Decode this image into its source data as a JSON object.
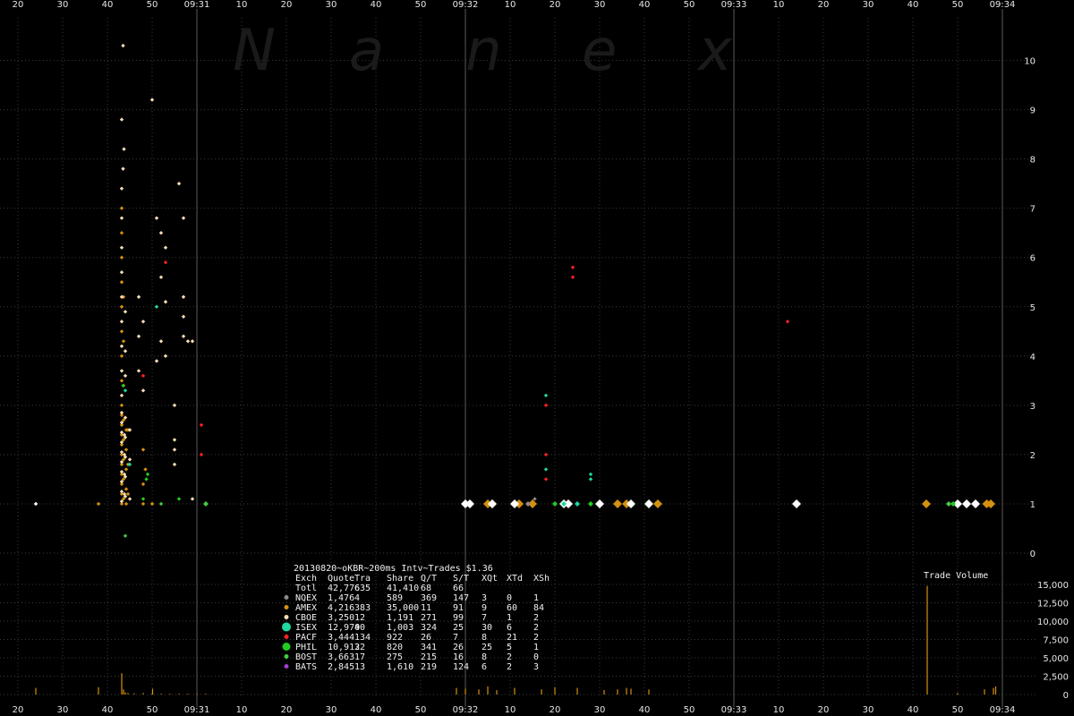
{
  "watermark": [
    "N",
    "a",
    "n",
    "e",
    "x"
  ],
  "colors": {
    "background": "#000000",
    "grid_dot": "#3a3a3a",
    "minute_line": "#5a5a5a",
    "NQEX": "#8c8c8c",
    "AMEX": "#d4900f",
    "CBOE": "#f5deb3",
    "ISEX": "#20d8a0",
    "PACF": "#ff2020",
    "PHIL": "#22cc22",
    "BOST": "#44cc44",
    "BATS": "#a040d0",
    "white": "#ffffff",
    "volume": "#d4900f"
  },
  "chart_data": [
    {
      "type": "scatter",
      "title": "",
      "xlabel": "",
      "ylabel": "",
      "x_unit": "seconds from 09:30:00",
      "xlim": [
        20,
        240
      ],
      "ylim": [
        0,
        10.5
      ],
      "y_ticks": [
        0,
        1,
        2,
        3,
        4,
        5,
        6,
        7,
        8,
        9,
        10
      ],
      "x_tick_labels": [
        {
          "t": 20,
          "label": "20"
        },
        {
          "t": 30,
          "label": "30"
        },
        {
          "t": 40,
          "label": "40"
        },
        {
          "t": 50,
          "label": "50"
        },
        {
          "t": 60,
          "label": "09:31"
        },
        {
          "t": 70,
          "label": "10"
        },
        {
          "t": 80,
          "label": "20"
        },
        {
          "t": 90,
          "label": "30"
        },
        {
          "t": 100,
          "label": "40"
        },
        {
          "t": 110,
          "label": "50"
        },
        {
          "t": 120,
          "label": "09:32"
        },
        {
          "t": 130,
          "label": "10"
        },
        {
          "t": 140,
          "label": "20"
        },
        {
          "t": 150,
          "label": "30"
        },
        {
          "t": 160,
          "label": "40"
        },
        {
          "t": 170,
          "label": "50"
        },
        {
          "t": 180,
          "label": "09:33"
        },
        {
          "t": 190,
          "label": "10"
        },
        {
          "t": 200,
          "label": "20"
        },
        {
          "t": 210,
          "label": "30"
        },
        {
          "t": 220,
          "label": "40"
        },
        {
          "t": 230,
          "label": "50"
        },
        {
          "t": 240,
          "label": "09:34"
        }
      ],
      "minute_lines": [
        60,
        120,
        180,
        240
      ],
      "grid": "dotted",
      "series": [
        {
          "color": "AMEX",
          "points": [
            [
              43.2,
              1
            ],
            [
              43.2,
              1.2
            ],
            [
              43.2,
              1.4
            ],
            [
              43.2,
              1.6
            ],
            [
              43.2,
              1.8
            ],
            [
              43.2,
              2
            ],
            [
              43.2,
              2.2
            ],
            [
              43.2,
              2.4
            ],
            [
              43.2,
              2.6
            ],
            [
              43.2,
              2.8
            ],
            [
              43.2,
              3
            ],
            [
              43.2,
              3.5
            ],
            [
              43.2,
              4
            ],
            [
              43.2,
              4.5
            ],
            [
              43.2,
              5
            ],
            [
              43.2,
              5.5
            ],
            [
              43.2,
              6
            ],
            [
              43.2,
              6.5
            ],
            [
              43.2,
              7
            ],
            [
              43.6,
              1.1
            ],
            [
              43.6,
              1.5
            ],
            [
              43.6,
              1.9
            ],
            [
              43.6,
              2.3
            ],
            [
              43.6,
              2.7
            ],
            [
              43.6,
              3.4
            ],
            [
              43.6,
              4.3
            ],
            [
              43.6,
              5.2
            ],
            [
              44.2,
              1
            ],
            [
              44.2,
              1.3
            ],
            [
              44.2,
              1.7
            ],
            [
              44.2,
              2.1
            ],
            [
              44.2,
              2.5
            ],
            [
              44.6,
              1.2
            ],
            [
              44.6,
              1.8
            ],
            [
              44.6,
              2.5
            ],
            [
              48,
              1
            ],
            [
              48,
              1.4
            ],
            [
              48,
              2.1
            ],
            [
              48.5,
              1.7
            ],
            [
              24,
              1
            ],
            [
              38,
              1
            ],
            [
              50,
              1
            ],
            [
              125,
              1
            ],
            [
              126,
              1
            ],
            [
              132,
              1
            ],
            [
              135,
              1
            ],
            [
              154,
              1
            ],
            [
              156,
              1
            ],
            [
              163,
              1
            ],
            [
              223,
              1
            ],
            [
              236.5,
              1
            ],
            [
              237.4,
              1
            ]
          ]
        },
        {
          "color": "CBOE",
          "points": [
            [
              43.2,
              1.05
            ],
            [
              43.2,
              1.25
            ],
            [
              43.2,
              1.45
            ],
            [
              43.2,
              1.65
            ],
            [
              43.2,
              1.85
            ],
            [
              43.2,
              2.05
            ],
            [
              43.2,
              2.25
            ],
            [
              43.2,
              2.45
            ],
            [
              43.2,
              2.65
            ],
            [
              43.2,
              2.85
            ],
            [
              43.2,
              3.2
            ],
            [
              43.2,
              3.7
            ],
            [
              43.2,
              4.2
            ],
            [
              43.2,
              4.7
            ],
            [
              43.2,
              5.2
            ],
            [
              43.2,
              5.7
            ],
            [
              43.2,
              6.2
            ],
            [
              43.2,
              6.8
            ],
            [
              43.2,
              7.4
            ],
            [
              43.5,
              7.8
            ],
            [
              43.2,
              8.8
            ],
            [
              43.7,
              8.2
            ],
            [
              43.5,
              10.3
            ],
            [
              44,
              1.15
            ],
            [
              44,
              1.55
            ],
            [
              44,
              1.95
            ],
            [
              44,
              2.35
            ],
            [
              44,
              2.75
            ],
            [
              44,
              3.6
            ],
            [
              44,
              4.1
            ],
            [
              44,
              4.9
            ],
            [
              45,
              1.1
            ],
            [
              45,
              1.9
            ],
            [
              45,
              2.5
            ],
            [
              47,
              3.7
            ],
            [
              47,
              4.4
            ],
            [
              47,
              5.2
            ],
            [
              48,
              3.3
            ],
            [
              48,
              4.7
            ],
            [
              50,
              9.2
            ],
            [
              51,
              6.8
            ],
            [
              51,
              3.9
            ],
            [
              52,
              6.5
            ],
            [
              52,
              5.6
            ],
            [
              52,
              4.3
            ],
            [
              53,
              6.2
            ],
            [
              53,
              5.1
            ],
            [
              53,
              4.0
            ],
            [
              55,
              3.0
            ],
            [
              55,
              2.3
            ],
            [
              55,
              2.1
            ],
            [
              55,
              1.8
            ],
            [
              56,
              7.5
            ],
            [
              57,
              6.8
            ],
            [
              57,
              5.2
            ],
            [
              57,
              4.8
            ],
            [
              57,
              4.4
            ],
            [
              58,
              4.3
            ],
            [
              59,
              1.1
            ],
            [
              59,
              4.3
            ],
            [
              43.8,
              1.2
            ],
            [
              43.8,
              1.6
            ],
            [
              43.8,
              2
            ],
            [
              43.8,
              2.4
            ]
          ]
        },
        {
          "color": "white",
          "points": [
            [
              24,
              1
            ],
            [
              120,
              1
            ],
            [
              121,
              1
            ],
            [
              126,
              1
            ],
            [
              131,
              1
            ],
            [
              142,
              1
            ],
            [
              143,
              1
            ],
            [
              150,
              1
            ],
            [
              161,
              1
            ],
            [
              157,
              1
            ],
            [
              194,
              1
            ],
            [
              230,
              1
            ],
            [
              232,
              1
            ],
            [
              234,
              1
            ]
          ]
        },
        {
          "color": "NQEX",
          "points": [
            [
              134,
              1
            ],
            [
              135.5,
              1.1
            ]
          ]
        },
        {
          "color": "ISEX",
          "points": [
            [
              145,
              1
            ],
            [
              148,
              1.6
            ],
            [
              148,
              1.5
            ],
            [
              138,
              3.2
            ],
            [
              138,
              1.7
            ],
            [
              44,
              3.3
            ],
            [
              45,
              1.8
            ],
            [
              51,
              5.0
            ],
            [
              142,
              1.0
            ]
          ]
        },
        {
          "color": "PACF",
          "points": [
            [
              138,
              3.0
            ],
            [
              138,
              2.0
            ],
            [
              138,
              1.5
            ],
            [
              144,
              5.8
            ],
            [
              144,
              5.6
            ],
            [
              48,
              3.6
            ],
            [
              53,
              5.9
            ],
            [
              61,
              2.6
            ],
            [
              61,
              2.0
            ],
            [
              192,
              4.7
            ]
          ]
        },
        {
          "color": "PHIL",
          "points": [
            [
              48.7,
              1.5
            ],
            [
              49,
              1.6
            ],
            [
              43.5,
              3.4
            ],
            [
              48,
              1.1
            ],
            [
              56,
              1.1
            ],
            [
              140,
              1
            ],
            [
              148,
              1
            ],
            [
              229,
              1
            ]
          ]
        },
        {
          "color": "BOST",
          "points": [
            [
              44,
              0.35
            ],
            [
              52,
              1.0
            ],
            [
              62,
              1.0
            ],
            [
              228,
              1.0
            ]
          ]
        }
      ]
    },
    {
      "type": "bar",
      "title": "Trade Volume",
      "xlim": [
        20,
        240
      ],
      "ylim": [
        0,
        16000
      ],
      "y_ticks": [
        0,
        2500,
        5000,
        7500,
        10000,
        12500,
        15000
      ],
      "y_tick_labels": [
        "0",
        "2,500",
        "5,000",
        "7,500",
        "10,000",
        "12,500",
        "15,000"
      ],
      "bars": [
        [
          43.2,
          2900
        ],
        [
          43.6,
          700
        ],
        [
          44,
          300
        ],
        [
          44.6,
          200
        ],
        [
          46,
          150
        ],
        [
          48,
          200
        ],
        [
          50,
          150
        ],
        [
          52,
          100
        ],
        [
          54,
          100
        ],
        [
          56,
          100
        ],
        [
          58,
          100
        ],
        [
          60,
          100
        ],
        [
          62,
          100
        ],
        [
          24,
          900
        ],
        [
          38,
          1000
        ],
        [
          50.1,
          800
        ],
        [
          118,
          900
        ],
        [
          120,
          800
        ],
        [
          123,
          700
        ],
        [
          125,
          1100
        ],
        [
          127,
          600
        ],
        [
          131,
          900
        ],
        [
          137,
          700
        ],
        [
          140,
          1000
        ],
        [
          145,
          900
        ],
        [
          151,
          600
        ],
        [
          154,
          700
        ],
        [
          156,
          900
        ],
        [
          157,
          800
        ],
        [
          161,
          700
        ],
        [
          223.2,
          14800
        ],
        [
          230,
          200
        ],
        [
          236,
          700
        ],
        [
          238,
          900
        ],
        [
          238.5,
          1100
        ]
      ]
    }
  ],
  "legend": {
    "title_line": "20130820~oKBR~200ms Intv~Trades $1.36",
    "header": [
      "Exch",
      "Quote",
      "Tra",
      "Share",
      "Q/T",
      "S/T",
      "XQt",
      "XTd",
      "XSh"
    ],
    "total": [
      "Totl",
      "42,776",
      "635",
      "41,410",
      "68",
      "66",
      "",
      "",
      ""
    ],
    "rows": [
      {
        "color": "NQEX",
        "cells": [
          "NQEX",
          "1,476",
          "4",
          "589",
          "369",
          "147",
          "3",
          "0",
          "1"
        ]
      },
      {
        "color": "AMEX",
        "cells": [
          "AMEX",
          "4,216",
          "383",
          "35,000",
          "11",
          "91",
          "9",
          "60",
          "84"
        ]
      },
      {
        "color": "CBOE",
        "cells": [
          "CBOE",
          "3,250",
          "12",
          "1,191",
          "271",
          "99",
          "7",
          "1",
          "2"
        ]
      },
      {
        "color": "ISEX",
        "cells": [
          "ISEX",
          "12,970",
          "40",
          "1,003",
          "324",
          "25",
          "30",
          "6",
          "2"
        ]
      },
      {
        "color": "PACF",
        "cells": [
          "PACF",
          "3,444",
          "134",
          "922",
          "26",
          "7",
          "8",
          "21",
          "2"
        ]
      },
      {
        "color": "PHIL",
        "cells": [
          "PHIL",
          "10,912",
          "32",
          "820",
          "341",
          "26",
          "25",
          "5",
          "1"
        ]
      },
      {
        "color": "BOST",
        "cells": [
          "BOST",
          "3,663",
          "17",
          "275",
          "215",
          "16",
          "8",
          "2",
          "0"
        ]
      },
      {
        "color": "BATS",
        "cells": [
          "BATS",
          "2,845",
          "13",
          "1,610",
          "219",
          "124",
          "6",
          "2",
          "3"
        ]
      }
    ]
  }
}
